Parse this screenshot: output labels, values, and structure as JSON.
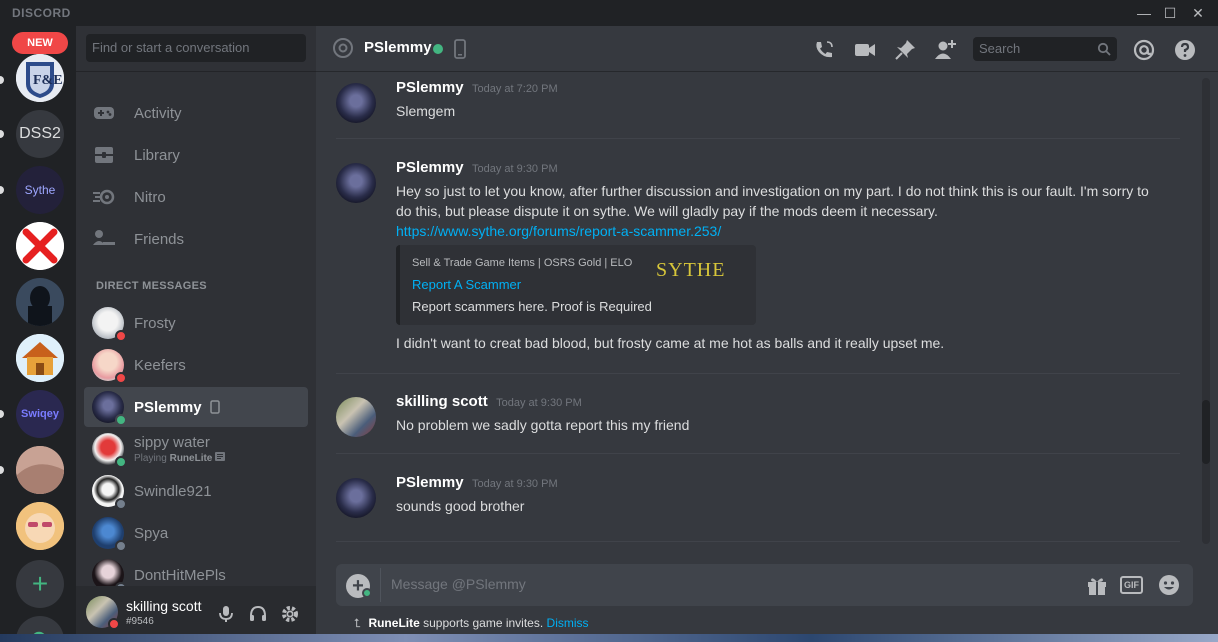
{
  "window": {
    "app_name": "DISCORD",
    "minimize": "—",
    "maximize": "☐",
    "close": "✕"
  },
  "guilds": {
    "new_badge": "NEW",
    "items": [
      {
        "label": "F&E"
      },
      {
        "label": "DSS2"
      },
      {
        "label": "Sythe"
      },
      {
        "label": ""
      },
      {
        "label": ""
      },
      {
        "label": ""
      },
      {
        "label": "Swiqey"
      },
      {
        "label": ""
      },
      {
        "label": ""
      }
    ],
    "add_label": "+"
  },
  "sidebar": {
    "search_placeholder": "Find or start a conversation",
    "nav": [
      {
        "label": "Activity",
        "icon": "gamepad-icon"
      },
      {
        "label": "Library",
        "icon": "library-icon"
      },
      {
        "label": "Nitro",
        "icon": "nitro-icon"
      },
      {
        "label": "Friends",
        "icon": "friends-icon"
      }
    ],
    "dm_header": "DIRECT MESSAGES",
    "dms": [
      {
        "name": "Frosty",
        "status": "dnd"
      },
      {
        "name": "Keefers",
        "status": "dnd"
      },
      {
        "name": "PSlemmy",
        "status": "online",
        "active": true
      },
      {
        "name": "sippy water",
        "status": "online",
        "activity_prefix": "Playing",
        "activity": "RuneLite"
      },
      {
        "name": "Swindle921",
        "status": "offline"
      },
      {
        "name": "Spya",
        "status": "offline"
      },
      {
        "name": "DontHitMePls",
        "status": "offline"
      }
    ]
  },
  "user_panel": {
    "username": "skilling scott",
    "tag": "#9546"
  },
  "chat": {
    "recipient": "PSlemmy",
    "search_placeholder": "Search",
    "messages": [
      {
        "author": "PSlemmy",
        "time": "Today at 7:20 PM",
        "lines": [
          "Slemgem"
        ]
      },
      {
        "author": "PSlemmy",
        "time": "Today at 9:30 PM",
        "lines": [
          "Hey so just to let you know, after further discussion and investigation on my part. I do not think this is our fault. I'm sorry to do this, but please dispute it on sythe. We will gladly pay if the mods deem it necessary."
        ],
        "link": "https://www.sythe.org/forums/report-a-scammer.253/",
        "embed": {
          "provider": "Sell & Trade Game Items | OSRS Gold | ELO",
          "title": "Report A Scammer",
          "description": "Report scammers here. Proof is Required",
          "thumb_text": "SYTHE"
        },
        "after": "I didn't want to creat bad blood, but frosty came at me hot as balls and it really upset me."
      },
      {
        "author": "skilling scott",
        "time": "Today at 9:30 PM",
        "lines": [
          "No problem we sadly gotta report this my friend"
        ]
      },
      {
        "author": "PSlemmy",
        "time": "Today at 9:30 PM",
        "lines": [
          "sounds good brother"
        ]
      }
    ],
    "composer_placeholder": "Message @PSlemmy",
    "gif_label": "GIF",
    "invite_notice": {
      "app": "RuneLite",
      "text": "supports game invites.",
      "dismiss": "Dismiss"
    }
  },
  "colors": {
    "accent_link": "#00b0f4",
    "online": "#43b581",
    "dnd": "#f04747",
    "offline": "#747f8d"
  }
}
